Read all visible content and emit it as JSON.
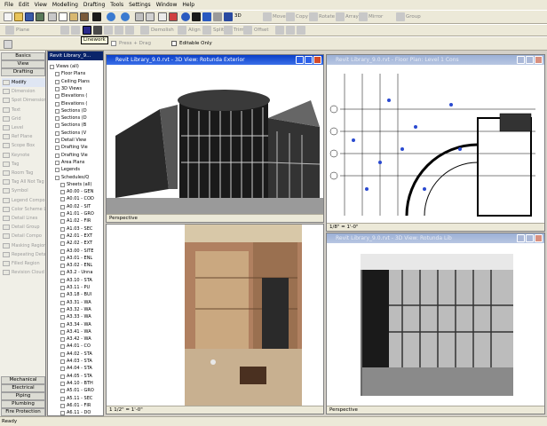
{
  "menu": [
    "File",
    "Edit",
    "View",
    "Modelling",
    "Drafting",
    "Tools",
    "Settings",
    "Window",
    "Help"
  ],
  "toolbar1": {
    "d3_label": "3D",
    "edit_labels": [
      "Move",
      "Copy",
      "Rotate",
      "Array",
      "Mirror",
      "Group"
    ]
  },
  "toolbar2": {
    "labels": [
      "Plane",
      "Demolish",
      "Align",
      "Split",
      "Trim",
      "Offset"
    ],
    "press_drag": "Press + Drag",
    "editable_only": "Editable Only",
    "tooltip": "Linework"
  },
  "palette": {
    "tabs_top": [
      "Basics",
      "View",
      "Drafting"
    ],
    "items": [
      "Modify",
      "Dimension",
      "Spot Dimension",
      "Text",
      "Grid",
      "Level",
      "Ref Plane",
      "Scope Box",
      "Keynote",
      "Tag",
      "Room Tag",
      "Tag All Not Tag",
      "Symbol",
      "Legend Compo",
      "Color Scheme L",
      "Detail Lines",
      "Detail Group",
      "Detail Compo",
      "Masking Region",
      "Repeating Deta",
      "Filled Region",
      "Revision Cloud"
    ],
    "tabs_bottom": [
      "Mechanical",
      "Electrical",
      "Piping",
      "Plumbing",
      "Fire Protection"
    ]
  },
  "browser": {
    "title": "Revit Library_9...",
    "items": [
      "Views (all)",
      "Floor Plans",
      "Ceiling Plans",
      "3D Views",
      "Elevations (",
      "Elevations (",
      "Sections (D",
      "Sections (D",
      "Sections (B",
      "Sections (V",
      "Detail View",
      "Drafting Vie",
      "Drafting Vie",
      "Area Plans",
      "Legends",
      "Schedules/Q",
      "Sheets (all)",
      "A0.00 - GEN",
      "A0.01 - COD",
      "A0.02 - SIT",
      "A1.01 - GRO",
      "A1.02 - FIR",
      "A1.03 - SEC",
      "A2.01 - EXT",
      "A2.02 - EXT",
      "A3.00 - SITE",
      "A3.01 - ENL",
      "A3.02 - ENL",
      "A3.2 - Unna",
      "A3.10 - STA",
      "A3.11 - PU",
      "A3.18 - BUI",
      "A3.31 - WA",
      "A3.32 - WA",
      "A3.33 - WA",
      "A3.34 - WA",
      "A3.41 - WA",
      "A3.42 - WA",
      "A4.01 - CO",
      "A4.02 - STA",
      "A4.03 - STA",
      "A4.04 - STA",
      "A4.05 - STA",
      "A4.10 - BTH",
      "A5.01 - GRO",
      "A5.11 - SEC",
      "A6.01 - FIR",
      "A6.11 - DO"
    ]
  },
  "views": {
    "v1_title": "Revit Library_9.0.rvt - 3D View: Rotunda Exterior",
    "v2_title": "Revit Library_9.0.rvt - Floor Plan: Level 1 Cons",
    "v3_title": "Revit Library_9.0.rvt - 3D View: Rotunda Lib",
    "v1_bar": "Perspective",
    "v2_bar": "1/8\" = 1'-0\"",
    "v3_bar": "Perspective",
    "v4_bar": "1 1/2\" = 1'-0\""
  },
  "status": "Ready",
  "colors": {
    "title_active": "#0a3ec8",
    "title_inactive": "#9bb0d6",
    "close": "#d44a2a"
  }
}
